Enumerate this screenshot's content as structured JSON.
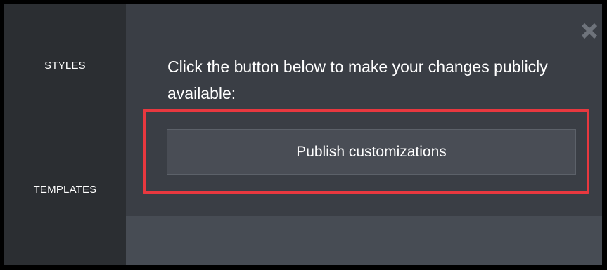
{
  "sidebar": {
    "items": [
      {
        "label": "STYLES"
      },
      {
        "label": "TEMPLATES"
      }
    ]
  },
  "panel": {
    "message": "Click the button below to make your changes publicly available:",
    "publish_label": "Publish customizations",
    "close_icon": "close-icon"
  },
  "colors": {
    "highlight": "#e8383f",
    "background": "#3a3e45",
    "sidebar": "#2b2e32"
  }
}
